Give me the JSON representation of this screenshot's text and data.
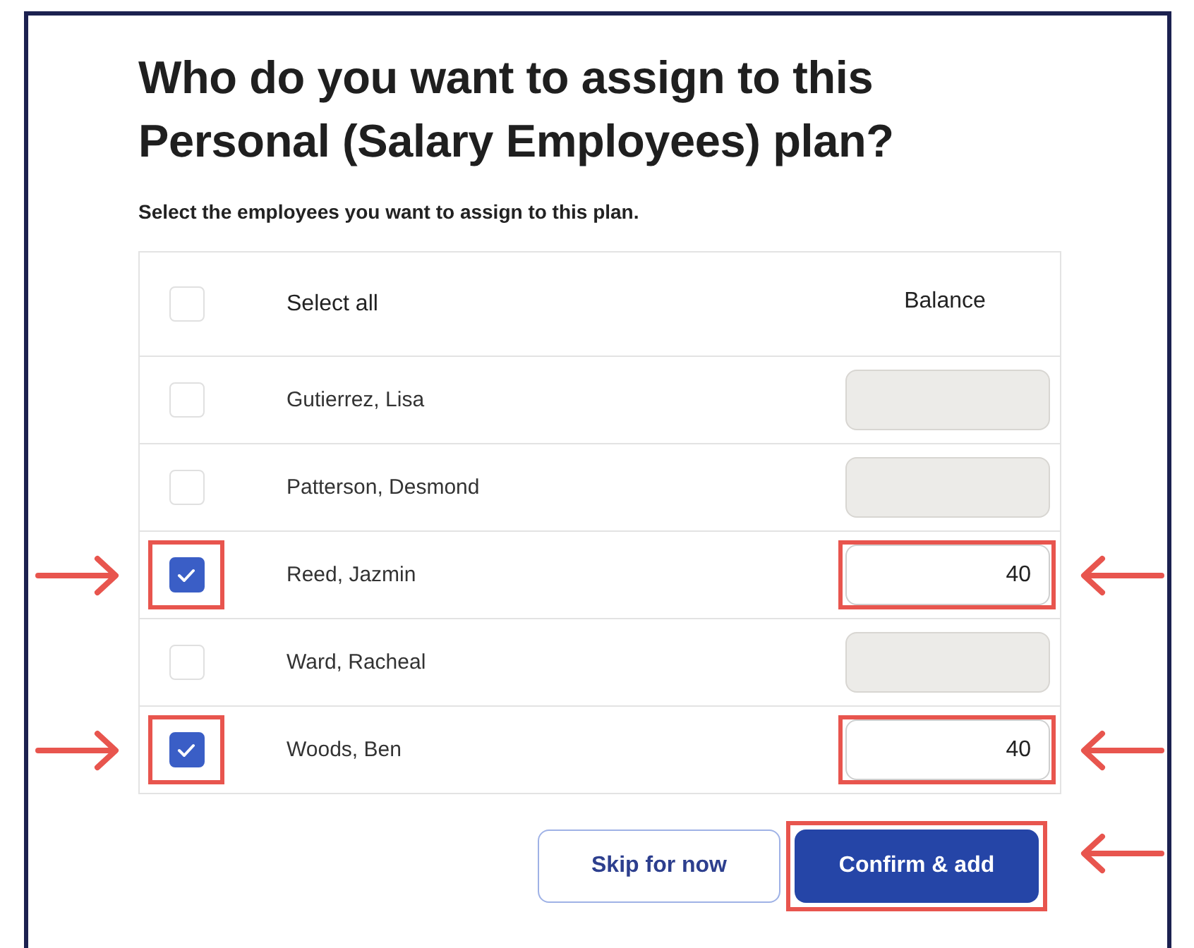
{
  "title": "Who do you want to assign to this Personal (Salary Employees) plan?",
  "subtitle": "Select the employees you want to assign to this plan.",
  "table": {
    "select_all": {
      "label": "Select all",
      "checked": false
    },
    "balance_header": "Balance",
    "rows": [
      {
        "name": "Gutierrez, Lisa",
        "checked": false,
        "annotated": false
      },
      {
        "name": "Patterson, Desmond",
        "checked": false,
        "annotated": false
      },
      {
        "name": "Reed, Jazmin",
        "checked": true,
        "balance": "40",
        "annotated": true
      },
      {
        "name": "Ward, Racheal",
        "checked": false,
        "annotated": false
      },
      {
        "name": "Woods, Ben",
        "checked": true,
        "balance": "40",
        "annotated": true
      }
    ]
  },
  "buttons": [
    {
      "label": "Skip for now",
      "kind": "secondary",
      "annotated": false
    },
    {
      "label": "Confirm & add",
      "kind": "primary",
      "annotated": true
    }
  ]
}
